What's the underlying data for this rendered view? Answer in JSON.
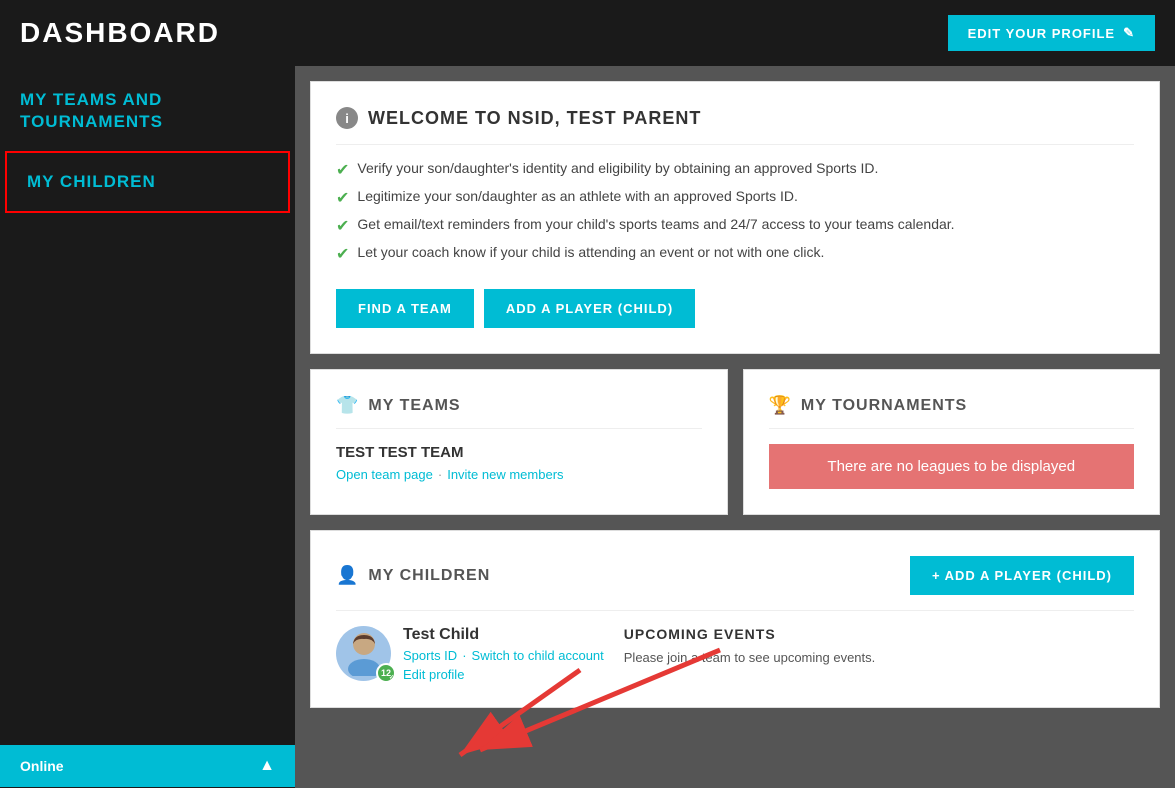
{
  "header": {
    "title": "DASHBOARD",
    "edit_profile_label": "EDIT YOUR PROFILE",
    "edit_icon": "✎"
  },
  "sidebar": {
    "items": [
      {
        "id": "my-teams-tournaments",
        "label": "MY TEAMS AND TOURNAMENTS",
        "active": false
      },
      {
        "id": "my-children",
        "label": "MY CHILDREN",
        "active": true
      }
    ]
  },
  "welcome": {
    "title": "WELCOME TO NSID, TEST PARENT",
    "bullet1": "Verify your son/daughter's identity and eligibility by obtaining an approved Sports ID.",
    "bullet2": "Legitimize your son/daughter as an athlete with an approved Sports ID.",
    "bullet3": "Get email/text reminders from your child's sports teams and 24/7 access to your teams calendar.",
    "bullet4": "Let your coach know if your child is attending an event or not with one click.",
    "find_team_btn": "FIND A TEAM",
    "add_player_btn": "ADD A PLAYER (CHILD)"
  },
  "my_teams": {
    "section_title": "MY TEAMS",
    "team_name": "TEST TEST TEAM",
    "open_team_link": "Open team page",
    "invite_link": "Invite new members"
  },
  "my_tournaments": {
    "section_title": "MY TOURNAMENTS",
    "no_leagues_msg": "There are no leagues to be displayed"
  },
  "my_children": {
    "section_title": "MY CHILDREN",
    "add_player_btn": "+ ADD A PLAYER (CHILD)",
    "child_name": "Test Child",
    "sports_id_link": "Sports ID",
    "switch_link": "Switch to child account",
    "edit_profile_link": "Edit profile",
    "avatar_badge": "12",
    "upcoming_title": "UPCOMING EVENTS",
    "upcoming_text": "Please join a team to see upcoming events."
  },
  "bottom_bar": {
    "label": "Online"
  }
}
